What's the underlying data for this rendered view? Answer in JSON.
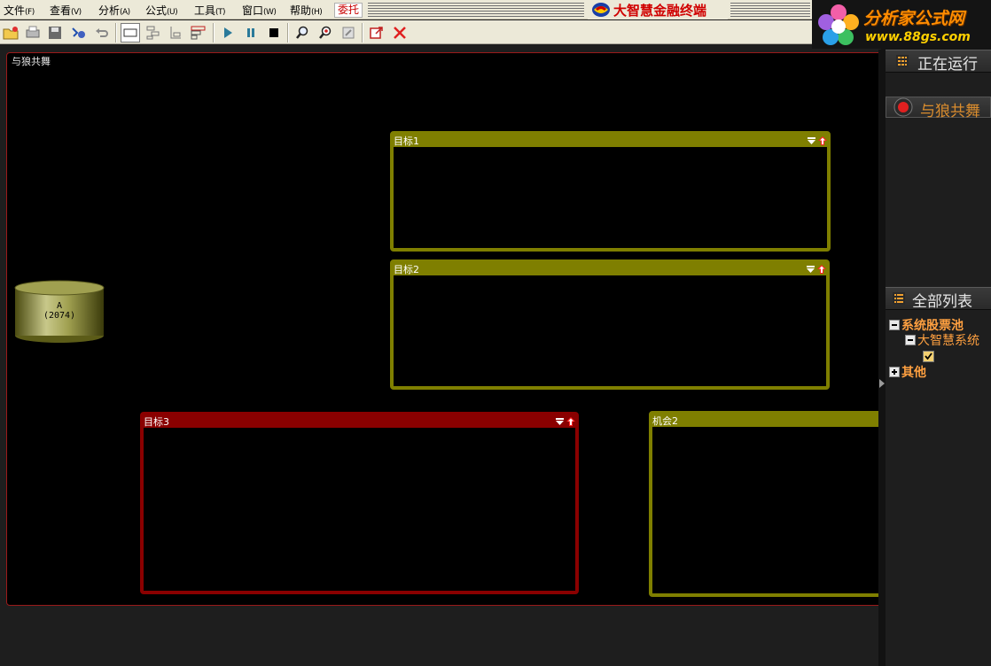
{
  "menu": [
    {
      "label": "文件",
      "hotkey": "(F)"
    },
    {
      "label": "查看",
      "hotkey": "(V)"
    },
    {
      "label": "分析",
      "hotkey": "(A)"
    },
    {
      "label": "公式",
      "hotkey": "(U)"
    },
    {
      "label": "工具",
      "hotkey": "(T)"
    },
    {
      "label": "窗口",
      "hotkey": "(W)"
    },
    {
      "label": "帮助",
      "hotkey": "(H)"
    }
  ],
  "entrust_label": "委托",
  "app_title": "大智慧金融终端",
  "watermark": {
    "title": "分析家公式网",
    "url": "www.88gs.com"
  },
  "canvas": {
    "title": "与狼共舞",
    "database": {
      "name": "A",
      "count": "(2074)"
    },
    "panels": [
      {
        "label": "目标1",
        "color": "#7f7f00"
      },
      {
        "label": "目标2",
        "color": "#7f7f00"
      },
      {
        "label": "目标3",
        "color": "#8a0000"
      },
      {
        "label": "机会2",
        "color": "#7f7f00"
      }
    ]
  },
  "sidebar": {
    "running_title": "正在运行",
    "strategy_button": "与狼共舞",
    "all_list_title": "全部列表",
    "tree": {
      "pool_label": "系统股票池",
      "pool_child": "大智慧系统",
      "other_label": "其他"
    }
  },
  "toolbar_icons": [
    "open-folder-icon",
    "print-icon",
    "save-icon",
    "tools-icon",
    "undo-icon",
    "layout-single-icon",
    "layout-tree-icon",
    "layout-branch-icon",
    "layout-list-icon",
    "play-icon",
    "pause-icon",
    "stop-icon",
    "search-icon",
    "search-stock-icon",
    "export-icon",
    "external-window-icon",
    "close-icon"
  ],
  "colors": {
    "panel_olive": "#7f7f00",
    "panel_red": "#8a0000",
    "canvas_bg": "#000000",
    "accent_orange": "#ffa040"
  }
}
